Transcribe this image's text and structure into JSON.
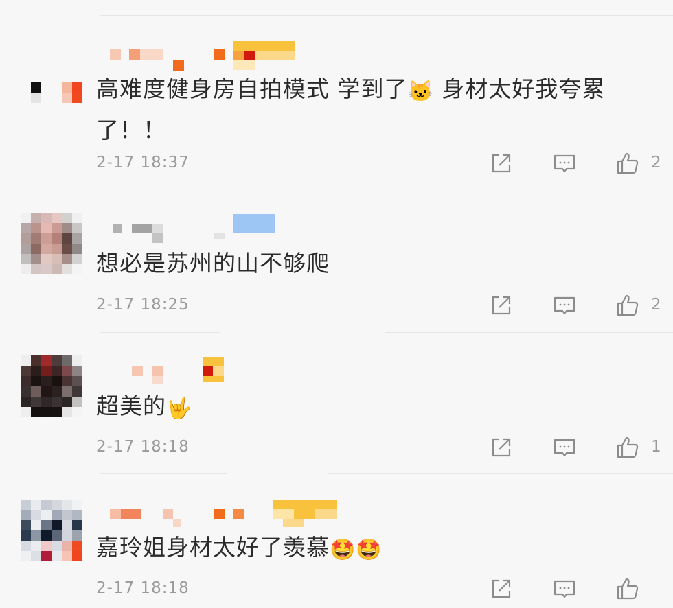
{
  "comments": [
    {
      "text": "高难度健身房自拍模式 学到了",
      "emoji_1": "🐱",
      "text_2": " 身材太好我夸累了！！",
      "emoji_2": "",
      "time": "2-17  18:37",
      "likes": "2",
      "icons": [
        "share-icon",
        "comment-icon",
        "like-icon"
      ]
    },
    {
      "text": "想必是苏州的山不够爬",
      "emoji_1": "",
      "text_2": "",
      "emoji_2": "",
      "time": "2-17  18:25",
      "likes": "2",
      "icons": [
        "share-icon",
        "comment-icon",
        "like-icon"
      ]
    },
    {
      "text": "超美的",
      "emoji_1": "🤟",
      "text_2": "",
      "emoji_2": "",
      "time": "2-17  18:18",
      "likes": "1",
      "icons": [
        "share-icon",
        "comment-icon",
        "like-icon"
      ]
    },
    {
      "text": "嘉玲姐身材太好了羡慕",
      "emoji_1": "🤩",
      "text_2": "",
      "emoji_2": "🤩",
      "time": "2-17  18:18",
      "likes": "",
      "icons": [
        "share-icon",
        "comment-icon",
        "like-icon"
      ]
    }
  ],
  "colors": {
    "background": "#f7f7f7",
    "text": "#2b2b2b",
    "meta": "#9a9a9a",
    "divider": "#e6e6e6",
    "icon": "#8c8c8c"
  }
}
